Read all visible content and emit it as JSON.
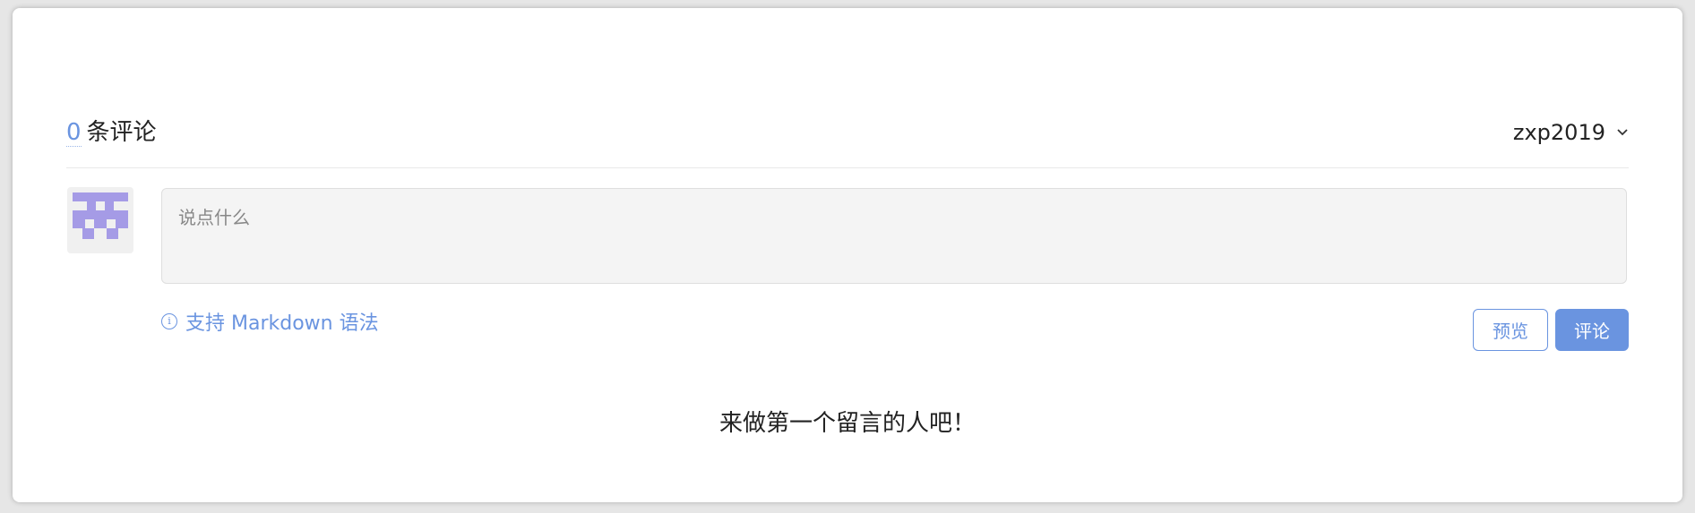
{
  "header": {
    "comment_count": "0",
    "comment_label": "条评论",
    "username": "zxp2019"
  },
  "avatar": {
    "color": "#a59be6"
  },
  "editor": {
    "placeholder": "说点什么",
    "value": ""
  },
  "hint": {
    "icon": "info-icon",
    "text": "支持 Markdown 语法"
  },
  "actions": {
    "preview_label": "预览",
    "submit_label": "评论"
  },
  "empty_state": {
    "text": "来做第一个留言的人吧！"
  },
  "colors": {
    "accent": "#6a94e0",
    "background": "#e6e6e6"
  }
}
